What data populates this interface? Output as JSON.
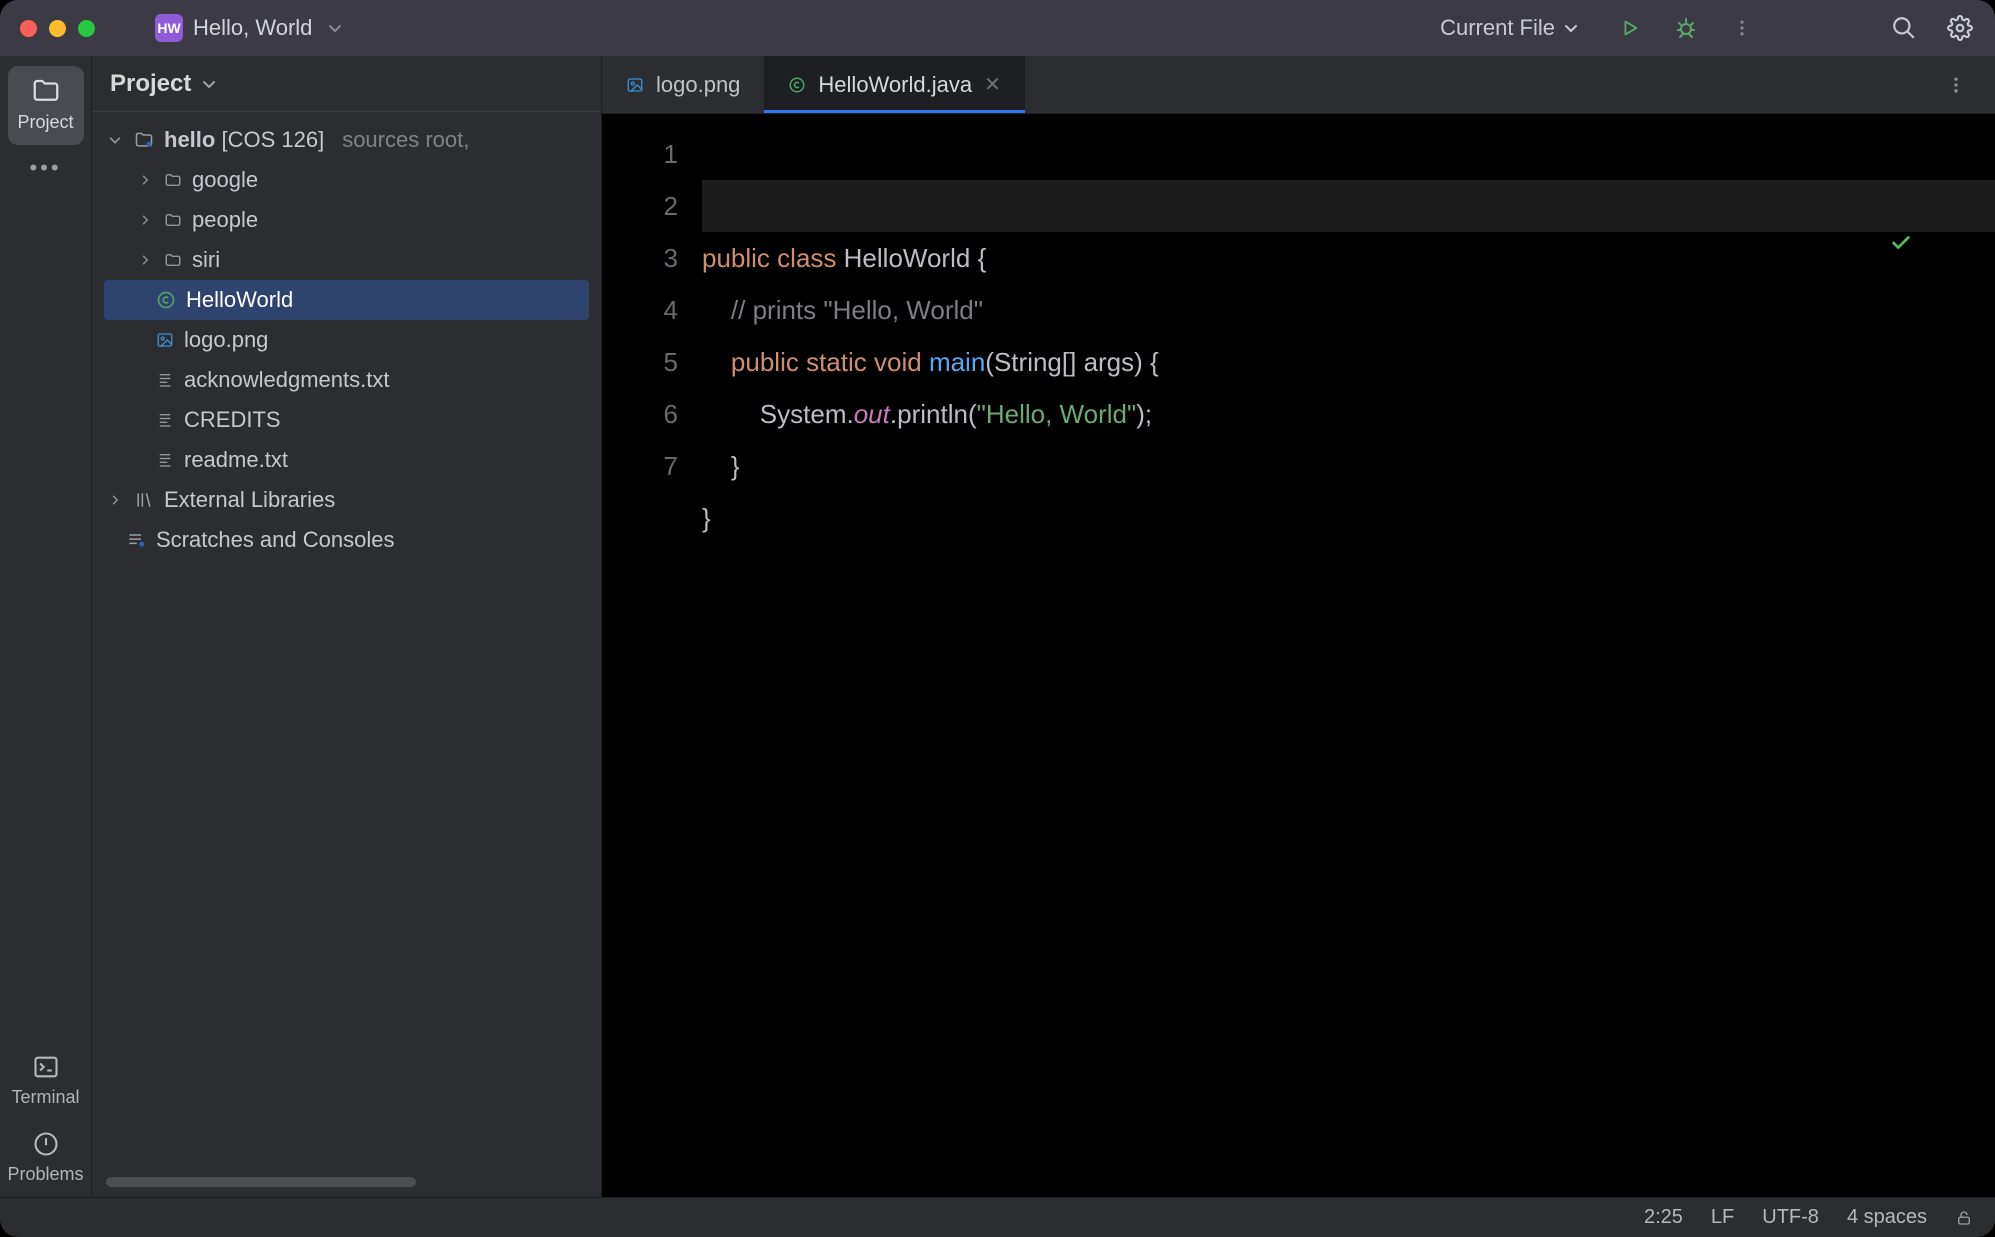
{
  "titlebar": {
    "app_badge": "HW",
    "project_name": "Hello, World",
    "run_config": "Current File"
  },
  "leftbar": {
    "project": "Project",
    "terminal": "Terminal",
    "problems": "Problems"
  },
  "projpane": {
    "header": "Project"
  },
  "tree": {
    "root": {
      "name": "hello",
      "suffix": "[COS 126]",
      "note": "sources root,"
    },
    "dirs": [
      "google",
      "people",
      "siri"
    ],
    "files": {
      "hello_world": "HelloWorld",
      "logo": "logo.png",
      "ack": "acknowledgments.txt",
      "credits": "CREDITS",
      "readme": "readme.txt"
    },
    "ext_lib": "External Libraries",
    "scratches": "Scratches and Consoles"
  },
  "tabs": {
    "t0": "logo.png",
    "t1": "HelloWorld.java"
  },
  "code": {
    "l1a": "public",
    "l1b": "class",
    "l1c": "HelloWorld",
    "l2": "// prints \"Hello, World\"",
    "l3a": "public",
    "l3b": "static",
    "l3c": "void",
    "l3d": "main",
    "l3e": "String",
    "l3f": "args",
    "l4a": "System",
    "l4b": "out",
    "l4c": "println",
    "l4d": "\"Hello, World\""
  },
  "gutter": [
    "1",
    "2",
    "3",
    "4",
    "5",
    "6",
    "7"
  ],
  "status": {
    "pos": "2:25",
    "eol": "LF",
    "enc": "UTF-8",
    "indent": "4 spaces"
  }
}
